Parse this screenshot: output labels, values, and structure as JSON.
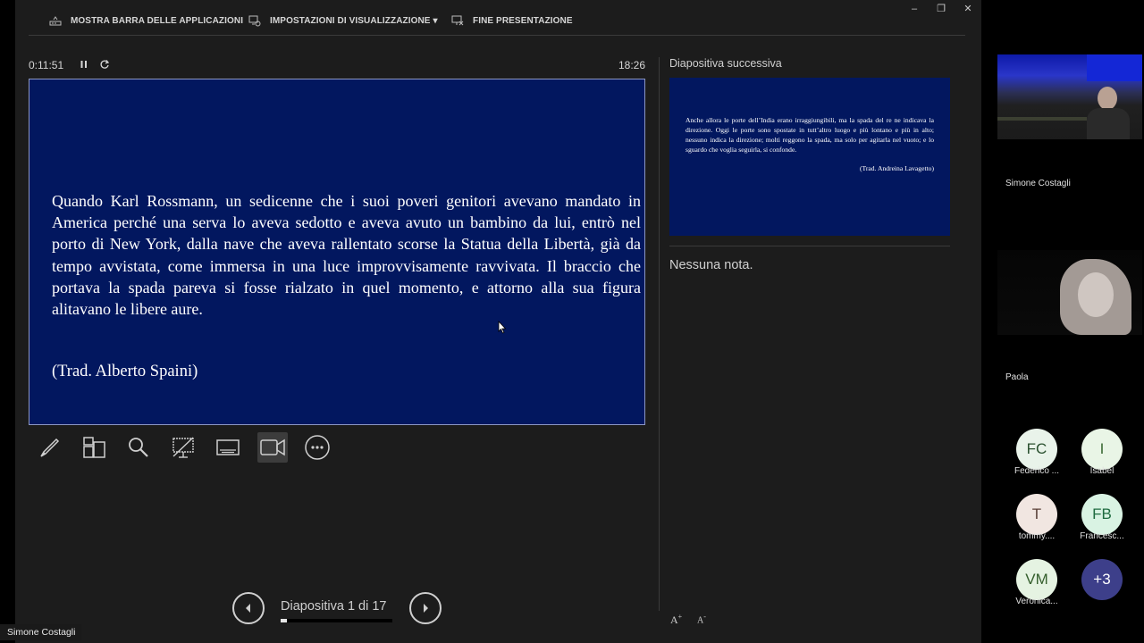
{
  "topbar": {
    "taskbar_label": "MOSTRA BARRA DELLE APPLICAZIONI",
    "display_settings_label": "IMPOSTAZIONI DI VISUALIZZAZIONE ▾",
    "end_show_label": "FINE PRESENTAZIONE",
    "minimize": "–",
    "restore": "❐",
    "close": "✕"
  },
  "timer": {
    "elapsed": "0:11:51",
    "clock": "18:26"
  },
  "current_slide": {
    "quote": "Quando Karl Rossmann, un sedicenne che i suoi poveri genitori avevano mandato in America perché una serva lo aveva sedotto e aveva avuto un bambino da lui, entrò nel porto di New York, dalla nave che aveva rallentato scorse la Statua della Libertà, già da tempo avvistata, come immersa in una luce improvvisamente ravvivata. Il braccio che portava la spada pareva si fosse rialzato in quel momento, e attorno alla sua figura alitavano le libere aure.",
    "credit": "(Trad. Alberto Spaini)"
  },
  "tools": [
    "pen-icon",
    "slides-grid-icon",
    "zoom-icon",
    "pointer-screen-icon",
    "subtitles-icon",
    "camera-icon",
    "more-icon"
  ],
  "navigation": {
    "label": "Diapositiva 1 di 17",
    "progress": 0.0588
  },
  "next_slide": {
    "label": "Diapositiva successiva",
    "quote": "Anche allora le porte dell’India erano irraggiungibili, ma la spada del re ne indicava la direzione. Oggi le porte sono spostate in tutt’altro luogo e più lontano e più in alto; nessuno indica la direzione; molti reggono la spada, ma solo per agitarla nel vuoto; e lo sguardo che voglia seguirla, si confonde.",
    "credit": "(Trad. Andreina Lavagetto)"
  },
  "notes": {
    "text": "Nessuna nota.",
    "font_increase": "A",
    "font_decrease": "A"
  },
  "meeting": {
    "participants": [
      {
        "name": "Simone Costagli"
      },
      {
        "name": "Paola"
      }
    ],
    "avatars": [
      {
        "initials": "FC",
        "name": "Federico ...",
        "bg": "#e9f3ea",
        "fg": "#2b5130"
      },
      {
        "initials": "I",
        "name": "Isabel",
        "bg": "#e9f5e6",
        "fg": "#3a6a35"
      },
      {
        "initials": "T",
        "name": "tommy....",
        "bg": "#f1e6e1",
        "fg": "#5a4038"
      },
      {
        "initials": "FB",
        "name": "Francesc...",
        "bg": "#d9f3e3",
        "fg": "#1f6b40"
      },
      {
        "initials": "VM",
        "name": "Veronica...",
        "bg": "#e5f3e2",
        "fg": "#355f2d"
      },
      {
        "initials": "+3",
        "name": "",
        "bg": "#3d3f8a",
        "fg": "#ffffff"
      }
    ],
    "speaker_tag": "Simone Costagli"
  }
}
